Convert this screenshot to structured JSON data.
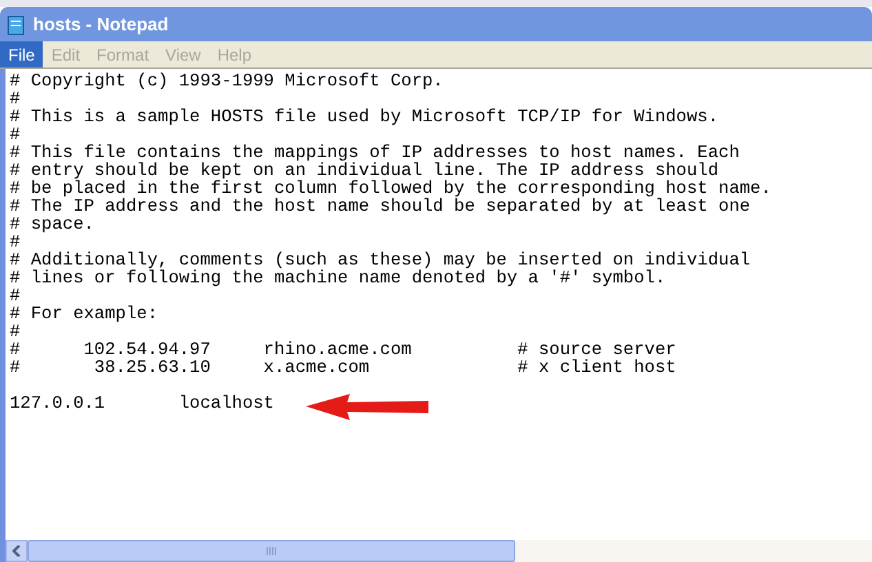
{
  "window": {
    "title": "hosts - Notepad"
  },
  "menu": [
    {
      "label": "File",
      "selected": true,
      "disabled": false
    },
    {
      "label": "Edit",
      "selected": false,
      "disabled": true
    },
    {
      "label": "Format",
      "selected": false,
      "disabled": true
    },
    {
      "label": "View",
      "selected": false,
      "disabled": true
    },
    {
      "label": "Help",
      "selected": false,
      "disabled": true
    }
  ],
  "document": {
    "blocks": [
      [
        "# Copyright (c) 1993-1999 Microsoft Corp.",
        "#",
        "# This is a sample HOSTS file used by Microsoft TCP/IP for Windows.",
        "#",
        "# This file contains the mappings of IP addresses to host names. Each",
        "# entry should be kept on an individual line. The IP address should",
        "# be placed in the first column followed by the corresponding host name.",
        "# The IP address and the host name should be separated by at least one",
        "# space.",
        "#",
        "# Additionally, comments (such as these) may be inserted on individual",
        "# lines or following the machine name denoted by a '#' symbol.",
        "#",
        "# For example:",
        "#",
        "#      102.54.94.97     rhino.acme.com          # source server",
        "#       38.25.63.10     x.acme.com              # x client host"
      ],
      [
        "127.0.0.1       localhost"
      ]
    ]
  }
}
